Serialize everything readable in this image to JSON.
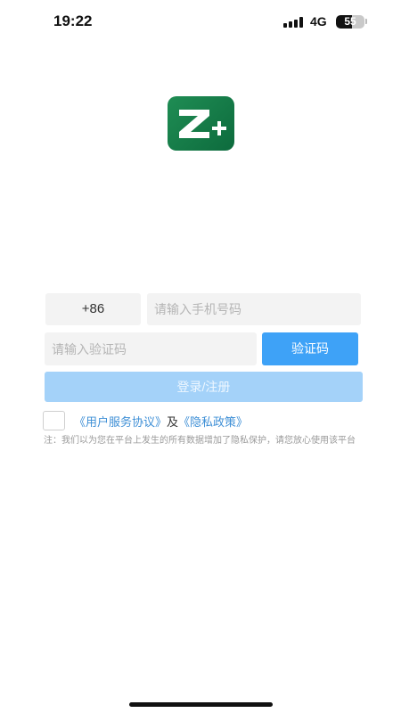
{
  "status_bar": {
    "time": "19:22",
    "network": "4G",
    "battery_level": "55"
  },
  "logo": {
    "icon": "z-plus-logo-icon",
    "color": "#1a7f4b"
  },
  "form": {
    "country_code": "+86",
    "phone_placeholder": "请输入手机号码",
    "phone_value": "",
    "code_placeholder": "请输入验证码",
    "code_value": "",
    "get_code_label": "验证码",
    "login_label": "登录/注册"
  },
  "agreement": {
    "checked": false,
    "user_agreement": "《用户服务协议》",
    "and": "及",
    "privacy_policy": "《隐私政策》"
  },
  "notice": "注：我们以为您在平台上发生的所有数据增加了隐私保护，请您放心使用该平台",
  "colors": {
    "accent": "#3ea2f7",
    "accent_disabled": "#a4d2f9",
    "link": "#3e8fd6",
    "brand_green": "#1a7f4b"
  }
}
